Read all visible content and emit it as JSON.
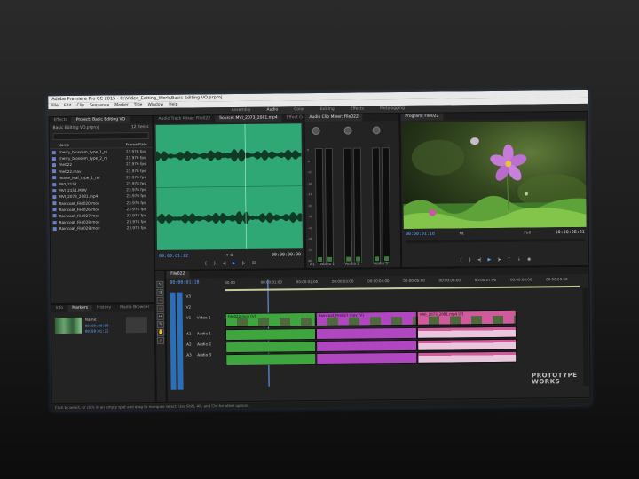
{
  "window": {
    "title": "Adobe Premiere Pro CC 2015 - C:\\Video_Editing_Work\\Basic Editing VO.prproj"
  },
  "menu": [
    "File",
    "Edit",
    "Clip",
    "Sequence",
    "Marker",
    "Title",
    "Window",
    "Help"
  ],
  "workspaces": [
    {
      "label": "Assembly",
      "active": false
    },
    {
      "label": "Audio",
      "active": true
    },
    {
      "label": "Color",
      "active": false
    },
    {
      "label": "Editing",
      "active": false
    },
    {
      "label": "Effects",
      "active": false
    },
    {
      "label": "Metalogging",
      "active": false
    }
  ],
  "project": {
    "tabs": [
      "Effects",
      "Project: Basic Editing VO"
    ],
    "name": "Basic Editing VO.prproj",
    "item_count": "12 Items",
    "search_placeholder": "",
    "columns": {
      "name": "Name",
      "frame_rate": "Frame Rate"
    },
    "items": [
      {
        "name": "cherry_blossom_type_1_re",
        "rate": "23.976 fps"
      },
      {
        "name": "cherry_blossom_type_2_re",
        "rate": "23.976 fps"
      },
      {
        "name": "File022",
        "rate": "23.976 fps"
      },
      {
        "name": "File022.mov",
        "rate": "23.976 fps"
      },
      {
        "name": "movie_leaf_type_1_rer",
        "rate": "23.976 fps"
      },
      {
        "name": "MVI_2151",
        "rate": "23.976 fps"
      },
      {
        "name": "MVI_2151.MOV",
        "rate": "23.976 fps"
      },
      {
        "name": "MVI_2073_2081.mp4",
        "rate": "23.976 fps"
      },
      {
        "name": "Raincoat_File020.mov",
        "rate": "23.976 fps"
      },
      {
        "name": "Raincoat_File026.mov",
        "rate": "23.976 fps"
      },
      {
        "name": "Raincoat_File027.mov",
        "rate": "23.976 fps"
      },
      {
        "name": "Raincoat_File028.mov",
        "rate": "23.976 fps"
      },
      {
        "name": "Raincoat_File029.mov",
        "rate": "23.976 fps"
      }
    ]
  },
  "lower_left": {
    "tabs": [
      "Info",
      "Markers",
      "History",
      "Media Browser"
    ],
    "active_tab": "Markers",
    "marker_name": "Name:",
    "in_tc": "00:00:00:00",
    "out_tc": "00:00:01:22"
  },
  "source": {
    "tabs": [
      "Audio Track Mixer: File022",
      "Source: MVI_2073_2081.mp4",
      "Effect Controls"
    ],
    "timecode": "00:00:01:22",
    "duration": "00:00:00:00"
  },
  "mixer": {
    "tab": "Audio Clip Mixer: File022",
    "channels": [
      "A1",
      "A2",
      "A3"
    ],
    "labels": [
      "Audio 1",
      "Audio 2",
      "Audio 3"
    ],
    "scale": [
      "0",
      "-6",
      "-12",
      "-18",
      "-24",
      "-30",
      "-36",
      "-42",
      "-48",
      "-54",
      "dB"
    ]
  },
  "program": {
    "tab": "Program: File022",
    "timecode": "00:00:01:18",
    "fit": "Fit",
    "quality": "Full",
    "duration": "00:00:08:21"
  },
  "timeline": {
    "tab": "File022",
    "timecode": "00:00:01:18",
    "ruler": [
      "00:00",
      "00:00:01:00",
      "00:00:02:00",
      "00:00:03:00",
      "00:00:04:00",
      "00:00:05:00",
      "00:00:06:00",
      "00:00:07:00",
      "00:00:08:00",
      "00:00:09:00"
    ],
    "video_tracks": [
      "V3",
      "V2",
      "V1"
    ],
    "audio_tracks": [
      "A1",
      "A2",
      "A3"
    ],
    "track_names": [
      "Video 1",
      "Audio 1",
      "Audio 2",
      "Audio 3"
    ],
    "clips": [
      {
        "label": "File022.mov [V]",
        "track": "V1",
        "start": 0.0,
        "end": 3.3,
        "color": "#3fa53f"
      },
      {
        "label": "Raincoat_File027.mov [V]",
        "track": "V1",
        "start": 3.3,
        "end": 7.0,
        "color": "#b046c0"
      },
      {
        "label": "MVI_2073_2081.mp4 [V]",
        "track": "V1",
        "start": 7.0,
        "end": 10.6,
        "color": "#d05a9c"
      }
    ],
    "timeline_length_sec": 13.0
  },
  "status": {
    "text": "Click to select, or click in an empty spot and drag to marquee select. Use Shift, Alt, and Ctrl for other options."
  },
  "watermark": [
    "PROTOTYPE",
    "WORKS"
  ],
  "colors": {
    "green_clip": "#3fa53f",
    "magenta_clip": "#b046c0",
    "pink_clip": "#d05a9c",
    "waveform_bg": "#2fa875",
    "timecode_blue": "#5fa0ff"
  }
}
